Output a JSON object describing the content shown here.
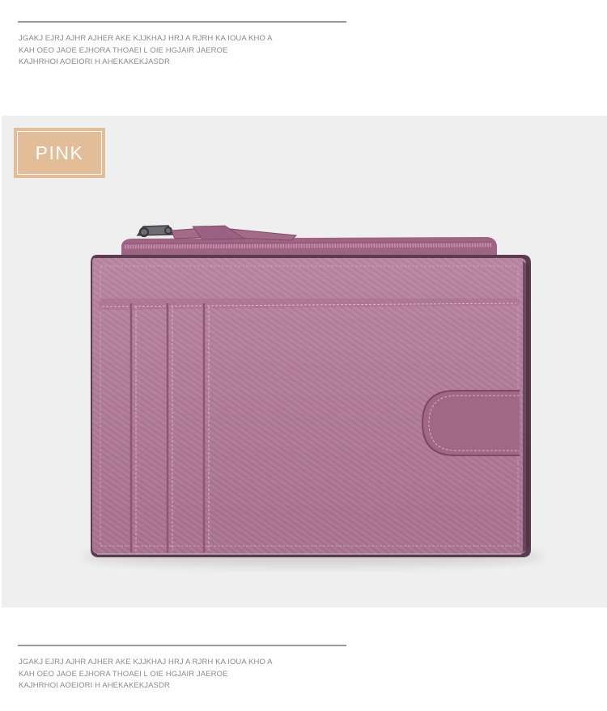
{
  "top_caption": {
    "lines": [
      "JGAKJ EJRJ AJHR  AJHER AKE KJJKHAJ HRJ A RJRH KA IOUA KHO A",
      "KAH OEO JAOE EJHORA THOAEI L OIE HGJAIR  JAEROE",
      "KAJHRHOI AOEIORI H AHEKAKEKJASDR"
    ]
  },
  "product": {
    "color_label": "PINK",
    "badge_color": "#e3bd97",
    "wallet_color": "#b07a99",
    "background_color": "#efefef"
  },
  "bottom_caption": {
    "lines": [
      "JGAKJ EJRJ AJHR  AJHER AKE KJJKHAJ HRJ A RJRH KA IOUA KHO A",
      "KAH OEO JAOE EJHORA THOAEI L OIE HGJAIR  JAEROE",
      "KAJHRHOI AOEIORI H AHEKAKEKJASDR"
    ]
  }
}
